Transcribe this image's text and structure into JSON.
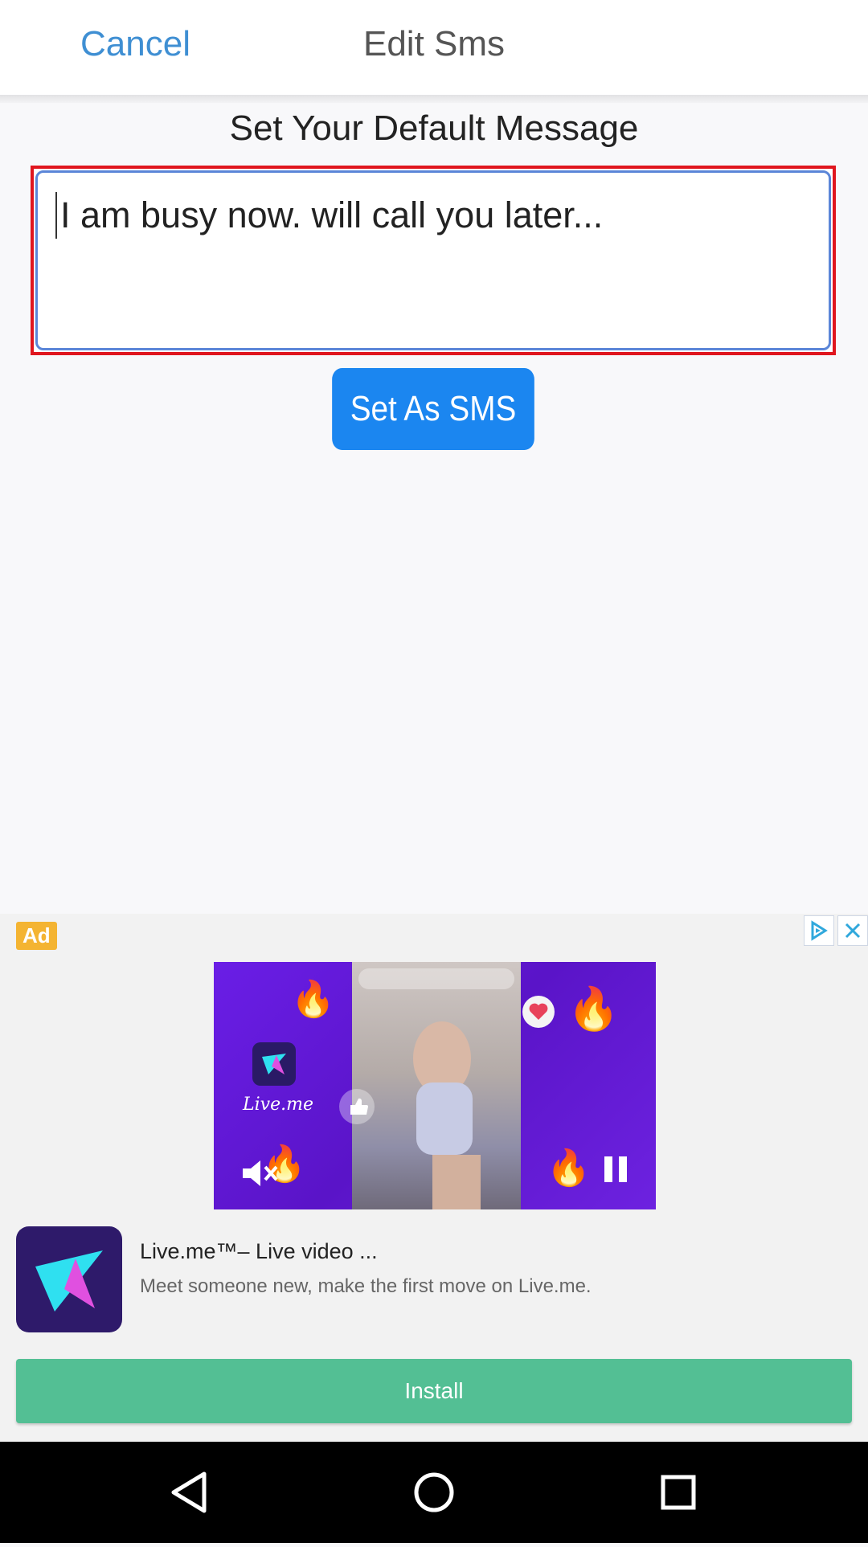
{
  "header": {
    "cancel_label": "Cancel",
    "title": "Edit Sms"
  },
  "main": {
    "section_title": "Set Your Default Message",
    "message_value": "I am busy now. will call you later...",
    "set_button_label": "Set As SMS"
  },
  "ad": {
    "badge": "Ad",
    "logo_text": "Live.me",
    "app_name": "Live.me™– Live video ...",
    "app_desc": "Meet someone new, make the first move on Live.me.",
    "install_label": "Install",
    "icons": [
      "ad-choices-icon",
      "close-icon",
      "play-icon",
      "heart-icon",
      "like-icon",
      "mute-icon",
      "pause-icon",
      "flame-icon",
      "livestar-icon"
    ]
  },
  "navbar": {
    "icons": [
      "back-icon",
      "home-icon",
      "recents-icon"
    ]
  },
  "colors": {
    "accent_blue": "#3f8fd3",
    "button_blue": "#1b86f0",
    "highlight_red": "#e0161e",
    "install_green": "#53bf94",
    "ad_badge_orange": "#f4b432",
    "ad_purple": "#6a1ee6"
  }
}
